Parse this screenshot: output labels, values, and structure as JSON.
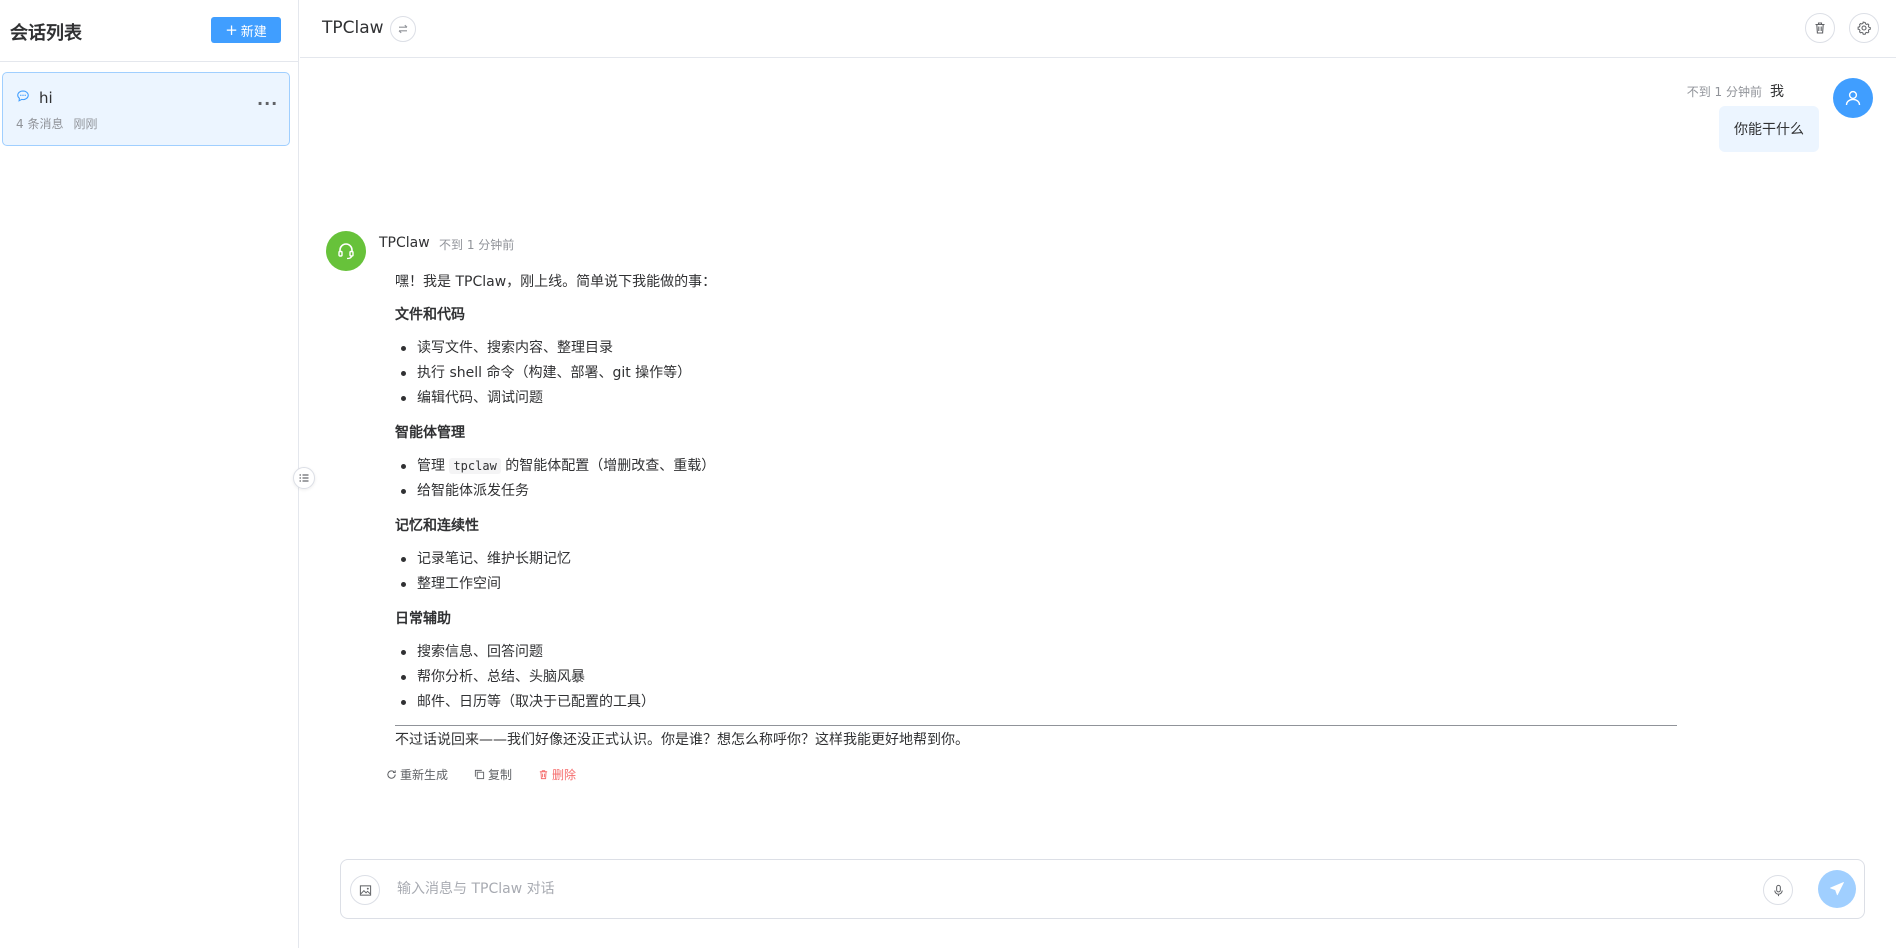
{
  "sidebar": {
    "title": "会话列表",
    "new_button": "新建",
    "conversations": [
      {
        "title": "hi",
        "message_count": "4 条消息",
        "time": "刚刚",
        "more": "..."
      }
    ]
  },
  "header": {
    "title": "TPClaw"
  },
  "messages": {
    "user": {
      "name": "我",
      "time": "不到 1 分钟前",
      "text": "你能干什么"
    },
    "bot": {
      "name": "TPClaw",
      "time": "不到 1 分钟前",
      "intro": "嘿！我是 TPClaw，刚上线。简单说下我能做的事：",
      "sections": [
        {
          "heading": "文件和代码",
          "items": [
            "读写文件、搜索内容、整理目录",
            "执行 shell 命令（构建、部署、git 操作等）",
            "编辑代码、调试问题"
          ]
        },
        {
          "heading": "智能体管理",
          "items_special": {
            "prefix": "管理 ",
            "code": "tpclaw",
            "suffix": " 的智能体配置（增删改查、重载）"
          },
          "items": [
            "给智能体派发任务"
          ]
        },
        {
          "heading": "记忆和连续性",
          "items": [
            "记录笔记、维护长期记忆",
            "整理工作空间"
          ]
        },
        {
          "heading": "日常辅助",
          "items": [
            "搜索信息、回答问题",
            "帮你分析、总结、头脑风暴",
            "邮件、日历等（取决于已配置的工具）"
          ]
        }
      ],
      "closing": "不过话说回来——我们好像还没正式认识。你是谁？想怎么称呼你？这样我能更好地帮到你。"
    },
    "actions": {
      "regenerate": "重新生成",
      "copy": "复制",
      "delete": "删除"
    }
  },
  "input": {
    "placeholder": "输入消息与 TPClaw 对话"
  },
  "colors": {
    "primary": "#409eff",
    "bot_avatar": "#67c23a",
    "danger": "#f56c6c",
    "active_bg": "#ecf5ff"
  }
}
